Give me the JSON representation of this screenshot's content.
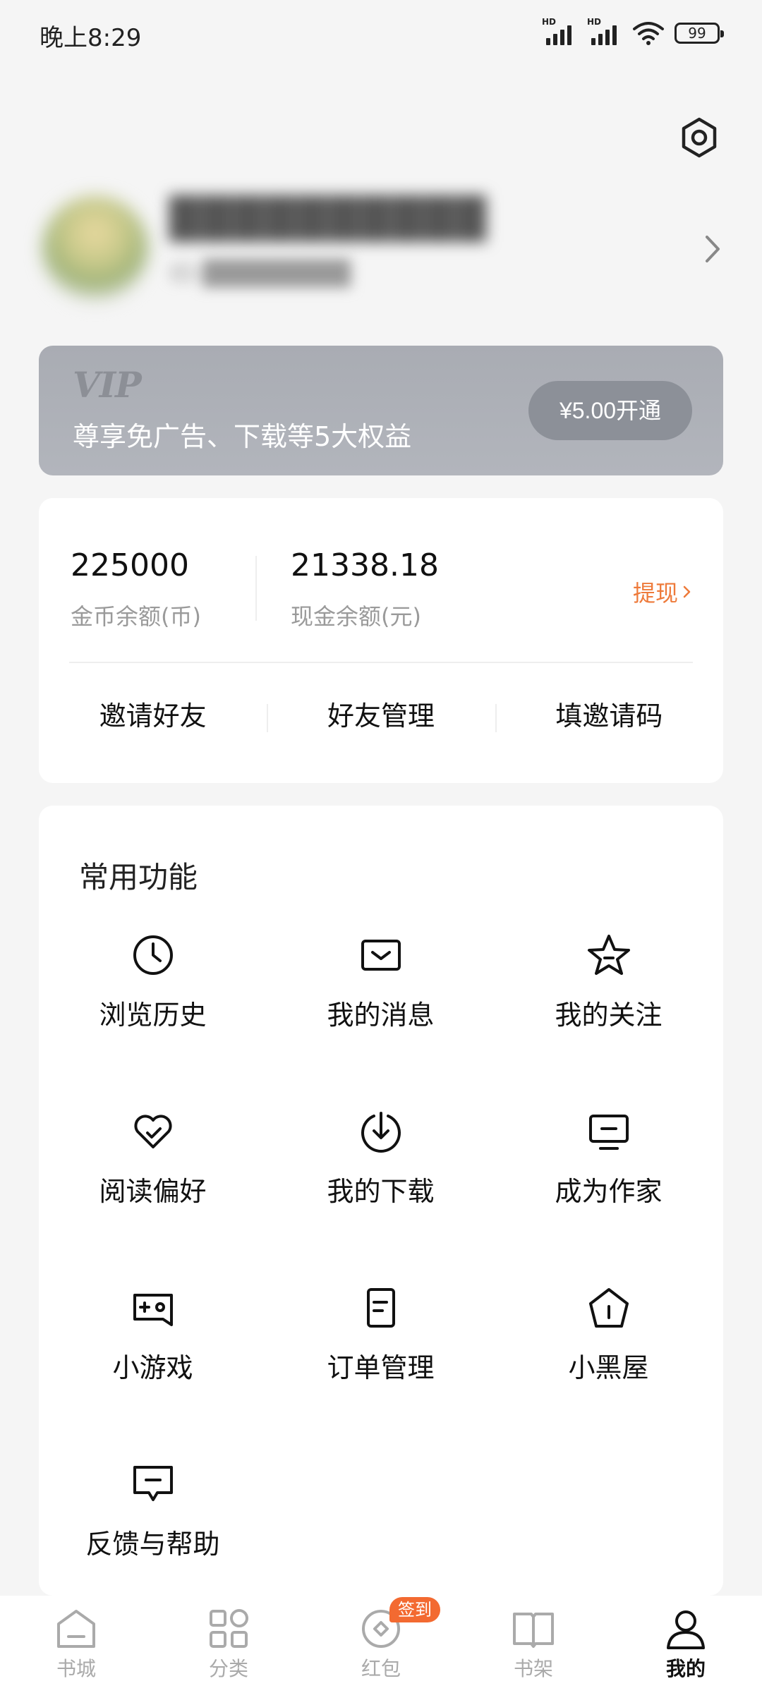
{
  "status_bar": {
    "time": "晚上8:29",
    "battery": "99",
    "hd_label": "HD"
  },
  "profile": {
    "username": "██████████",
    "user_id": "ID:████████"
  },
  "vip": {
    "logo": "VIP",
    "description": "尊享免广告、下载等5大权益",
    "button_label": "¥5.00开通"
  },
  "wallet": {
    "coin_amount": "225000",
    "coin_label": "金币余额(币)",
    "cash_amount": "21338.18",
    "cash_label": "现金余额(元)",
    "withdraw_label": "提现",
    "links": [
      "邀请好友",
      "好友管理",
      "填邀请码"
    ]
  },
  "functions": {
    "title": "常用功能",
    "items": [
      {
        "label": "浏览历史",
        "icon": "clock-icon"
      },
      {
        "label": "我的消息",
        "icon": "message-icon"
      },
      {
        "label": "我的关注",
        "icon": "star-icon"
      },
      {
        "label": "阅读偏好",
        "icon": "heart-check-icon"
      },
      {
        "label": "我的下载",
        "icon": "download-icon"
      },
      {
        "label": "成为作家",
        "icon": "monitor-icon"
      },
      {
        "label": "小游戏",
        "icon": "gamepad-icon"
      },
      {
        "label": "订单管理",
        "icon": "document-icon"
      },
      {
        "label": "小黑屋",
        "icon": "house-alert-icon"
      },
      {
        "label": "反馈与帮助",
        "icon": "feedback-icon"
      }
    ]
  },
  "bottom_nav": {
    "items": [
      {
        "label": "书城",
        "icon": "home-icon"
      },
      {
        "label": "分类",
        "icon": "grid-icon"
      },
      {
        "label": "红包",
        "icon": "red-packet-icon"
      },
      {
        "label": "书架",
        "icon": "book-icon"
      },
      {
        "label": "我的",
        "icon": "user-icon"
      }
    ],
    "active_index": 4,
    "badge": "签到"
  },
  "colors": {
    "accent": "#ee7a3a",
    "badge": "#f36a31",
    "vip_bg": "#aeb1b8",
    "background": "#f5f5f5"
  }
}
